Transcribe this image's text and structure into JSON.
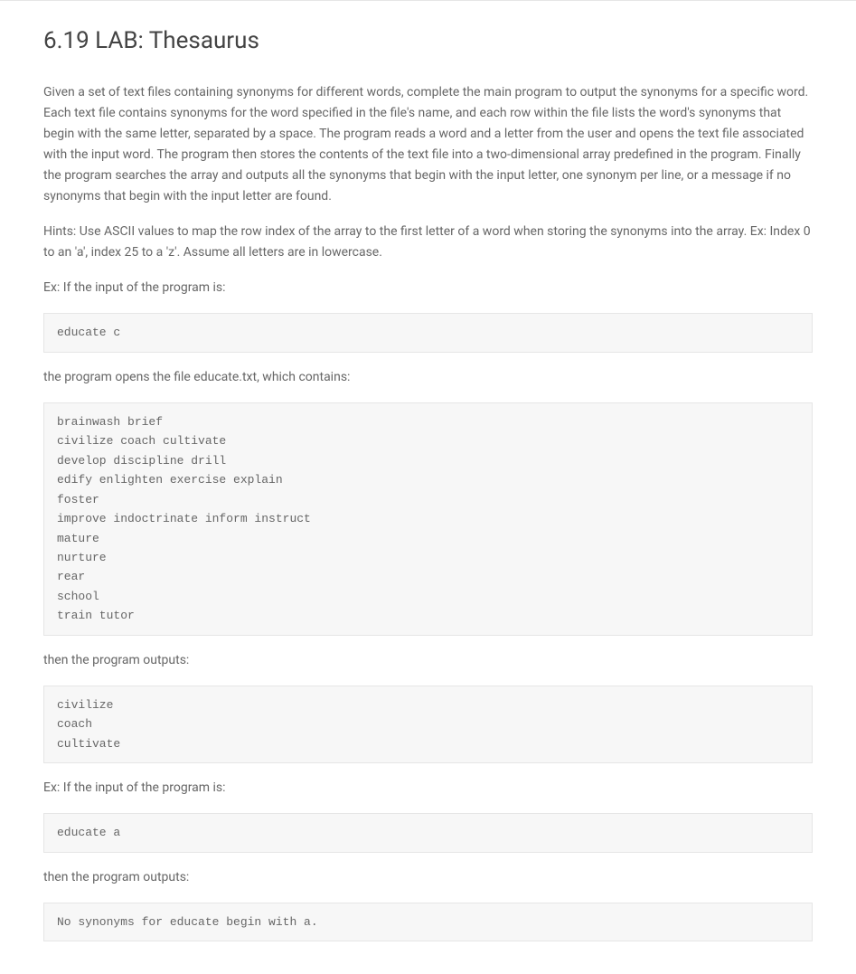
{
  "title": "6.19 LAB: Thesaurus",
  "paragraphs": {
    "intro": "Given a set of text files containing synonyms for different words, complete the main program to output the synonyms for a specific word. Each text file contains synonyms for the word specified in the file's name, and each row within the file lists the word's synonyms that begin with the same letter, separated by a space. The program reads a word and a letter from the user and opens the text file associated with the input word. The program then stores the contents of the text file into a two-dimensional array predefined in the program. Finally the program searches the array and outputs all the synonyms that begin with the input letter, one synonym per line, or a message if no synonyms that begin with the input letter are found.",
    "hints": "Hints: Use ASCII values to map the row index of the array to the first letter of a word when storing the synonyms into the array. Ex: Index 0 to an 'a', index 25 to a 'z'. Assume all letters are in lowercase.",
    "ex1_prompt": "Ex: If the input of the program is:",
    "ex1_opens": "the program opens the file educate.txt, which contains:",
    "ex1_output_label": "then the program outputs:",
    "ex2_prompt": "Ex: If the input of the program is:",
    "ex2_output_label": "then the program outputs:"
  },
  "code": {
    "input1": "educate c",
    "file_contents": "brainwash brief\ncivilize coach cultivate\ndevelop discipline drill\nedify enlighten exercise explain\nfoster\nimprove indoctrinate inform instruct\nmature\nnurture\nrear\nschool\ntrain tutor",
    "output1": "civilize\ncoach\ncultivate",
    "input2": "educate a",
    "output2": "No synonyms for educate begin with a."
  }
}
